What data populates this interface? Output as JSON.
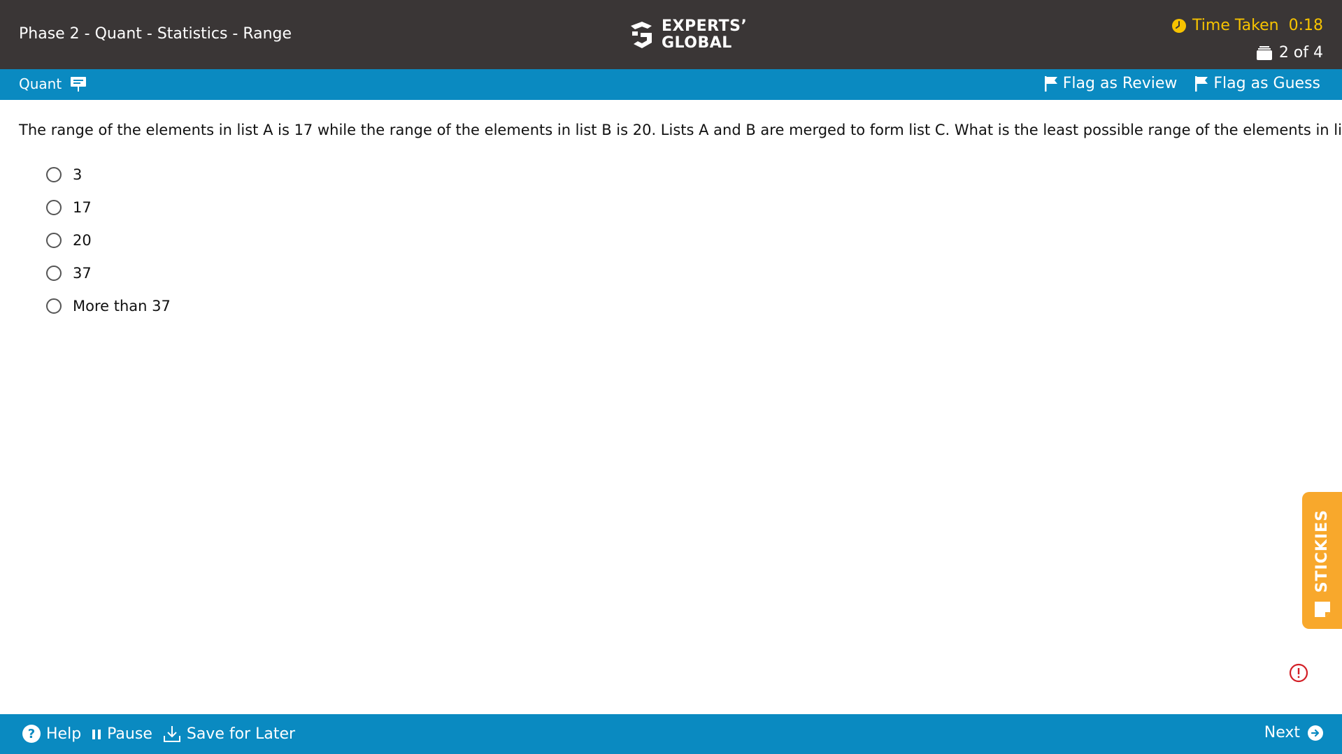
{
  "header": {
    "breadcrumb": "Phase 2 - Quant - Statistics - Range",
    "logo_line1": "EXPERTS’",
    "logo_line2": "GLOBAL",
    "time_label": "Time Taken",
    "time_value": "0:18",
    "question_counter": "2 of 4"
  },
  "subbar": {
    "section": "Quant",
    "flag_review": "Flag as Review",
    "flag_guess": "Flag as Guess"
  },
  "question": {
    "text": "The range of the elements in list A is 17 while the range of the elements in list B is 20. Lists A and B are merged to form list C. What is the least possible range of the elements in list C ?",
    "options": [
      "3",
      "17",
      "20",
      "37",
      "More than 37"
    ]
  },
  "stickies": {
    "label": "STICKIES"
  },
  "footer": {
    "help": "Help",
    "pause": "Pause",
    "save_later": "Save for Later",
    "next": "Next"
  },
  "colors": {
    "header_bg": "#3a3636",
    "bar_blue": "#0a8ac1",
    "timer_yellow": "#f7c300",
    "stickies_orange": "#f8a82c",
    "report_red": "#d31f26"
  }
}
